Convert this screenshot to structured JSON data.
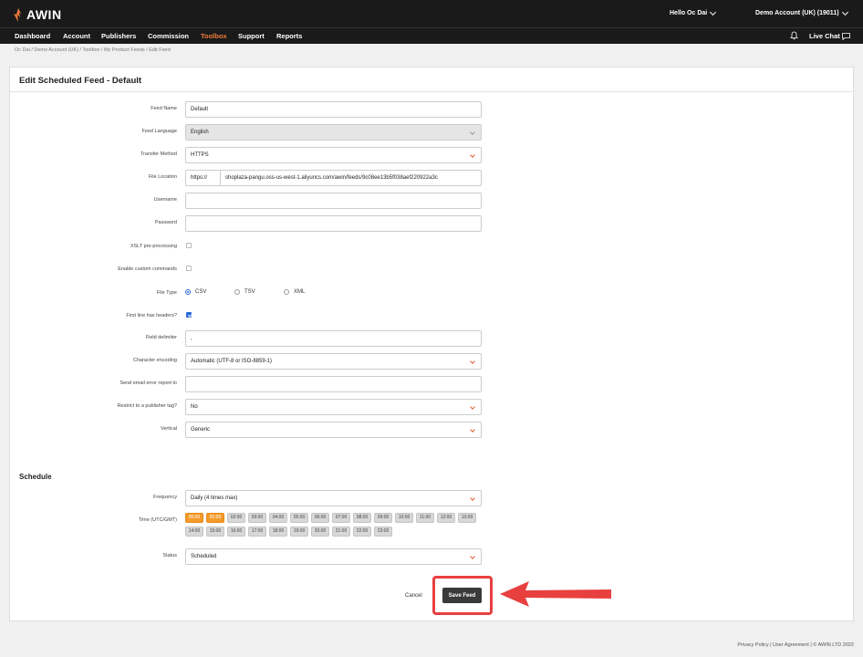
{
  "brand": {
    "name": "AWIN",
    "accent": "#f07c3c"
  },
  "topbar": {
    "user": "Hello Oc Dai",
    "account": "Demo Account (UK) (19011)"
  },
  "nav": {
    "items": [
      "Dashboard",
      "Account",
      "Publishers",
      "Commission",
      "Toolbox",
      "Support",
      "Reports"
    ],
    "active": "Toolbox",
    "live_chat": "Live Chat"
  },
  "breadcrumb": "Oc Dai / Demo Account (UK) / Toolbox / My Product Feeds / Edit Feed",
  "page_title": "Edit Scheduled Feed - Default",
  "form": {
    "feed_name": {
      "label": "Feed Name",
      "value": "Default"
    },
    "feed_language": {
      "label": "Feed Language",
      "value": "English"
    },
    "transfer_method": {
      "label": "Transfer Method",
      "value": "HTTPS"
    },
    "file_location": {
      "label": "File Location",
      "prefix": "https://",
      "value": "shoplaza-pangu.oss-us-west-1.aliyuncs.com/awin/feeds/9c08ee13b5f038aef220922a3c"
    },
    "username": {
      "label": "Username",
      "value": ""
    },
    "password": {
      "label": "Password",
      "value": ""
    },
    "xslt": {
      "label": "XSLT pre-processing",
      "checked": false
    },
    "custom_commands": {
      "label": "Enable custom commands",
      "checked": false
    },
    "file_type": {
      "label": "File Type",
      "options": [
        "CSV",
        "TSV",
        "XML"
      ],
      "selected": "CSV"
    },
    "first_line_headers": {
      "label": "First line has headers?",
      "checked": true
    },
    "field_delimiter": {
      "label": "Field delimiter",
      "value": ","
    },
    "char_encoding": {
      "label": "Character encoding",
      "value": "Automatic (UTF-8 or ISO-8859-1)"
    },
    "email_report": {
      "label": "Send email error report to",
      "value": ""
    },
    "publisher_tag": {
      "label": "Restrict to a publisher tag?",
      "value": "No"
    },
    "vertical": {
      "label": "Vertical",
      "value": "Generic"
    }
  },
  "schedule": {
    "title": "Schedule",
    "frequency": {
      "label": "Frequency",
      "value": "Daily (4 times max)"
    },
    "time_label": "Time (UTC/GMT)",
    "times": [
      "00:00",
      "01:00",
      "02:00",
      "03:00",
      "04:00",
      "05:00",
      "06:00",
      "07:00",
      "08:00",
      "09:00",
      "10:00",
      "11:00",
      "12:00",
      "13:00",
      "14:00",
      "15:00",
      "16:00",
      "17:00",
      "18:00",
      "19:00",
      "20:00",
      "21:00",
      "22:00",
      "23:00"
    ],
    "selected_times": [
      "00:00",
      "01:00"
    ],
    "status": {
      "label": "Status",
      "value": "Scheduled"
    }
  },
  "actions": {
    "cancel": "Cancel",
    "save": "Save Feed"
  },
  "footer": "Privacy Policy | User Agreement | © AWIN LTD 2022"
}
